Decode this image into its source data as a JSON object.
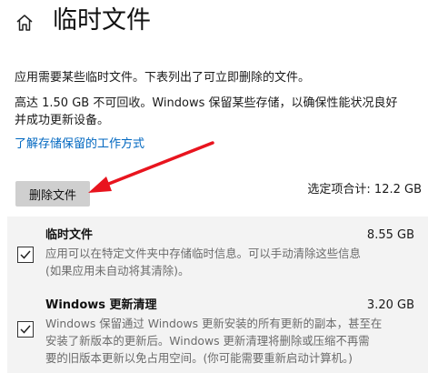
{
  "header": {
    "title": "临时文件",
    "home_icon": "home-icon"
  },
  "intro": {
    "line1": "应用需要某些临时文件。下表列出了可立即删除的文件。",
    "line2a": "高达 1.50 GB 不可回收。Windows 保留某些存储，以确保性能状况良好",
    "line2b": "并成功更新设备。",
    "link": "了解存储保留的工作方式"
  },
  "actions": {
    "delete_label": "删除文件",
    "total": "选定项合计: 12.2 GB"
  },
  "items": [
    {
      "title": "临时文件",
      "size": "8.55 GB",
      "checked": true,
      "desc": [
        "应用可以在特定文件夹中存储临时信息。可以手动清除这些信息",
        "(如果应用未自动将其清除)。"
      ]
    },
    {
      "title": "Windows 更新清理",
      "size": "3.20 GB",
      "checked": true,
      "desc": [
        "Windows 保留通过 Windows 更新安装的所有更新的副本，甚至在",
        "安装了新版本的更新后。Windows 更新清理将删除或压缩不再需",
        "要的旧版本更新以免占用空间。(你可能需要重新启动计算机。)"
      ]
    }
  ],
  "colors": {
    "link": "#0067c0",
    "button": "#cfcfcf",
    "arrow": "#e8141e",
    "panel": "#f3f3f3"
  }
}
